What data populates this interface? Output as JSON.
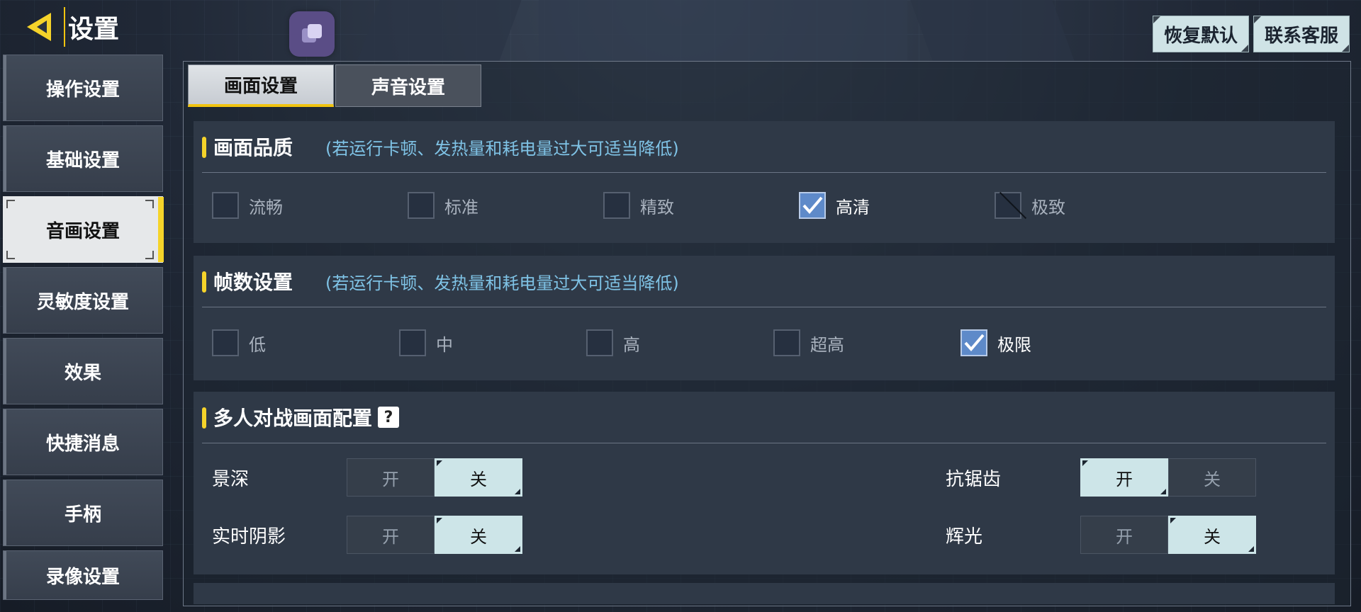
{
  "header": {
    "back_title": "设置",
    "buttons": {
      "restore_default": "恢复默认",
      "contact_support": "联系客服"
    }
  },
  "sidebar": {
    "items": [
      {
        "label": "操作设置",
        "active": false
      },
      {
        "label": "基础设置",
        "active": false
      },
      {
        "label": "音画设置",
        "active": true
      },
      {
        "label": "灵敏度设置",
        "active": false
      },
      {
        "label": "效果",
        "active": false
      },
      {
        "label": "快捷消息",
        "active": false
      },
      {
        "label": "手柄",
        "active": false
      },
      {
        "label": "录像设置",
        "active": false
      }
    ]
  },
  "tabs": [
    {
      "label": "画面设置",
      "active": true
    },
    {
      "label": "声音设置",
      "active": false
    }
  ],
  "quality": {
    "title": "画面品质",
    "hint": "(若运行卡顿、发热量和耗电量过大可适当降低)",
    "options": [
      {
        "label": "流畅",
        "state": "unchecked"
      },
      {
        "label": "标准",
        "state": "unchecked"
      },
      {
        "label": "精致",
        "state": "unchecked"
      },
      {
        "label": "高清",
        "state": "checked"
      },
      {
        "label": "极致",
        "state": "disabled"
      }
    ]
  },
  "framerate": {
    "title": "帧数设置",
    "hint": "(若运行卡顿、发热量和耗电量过大可适当降低)",
    "options": [
      {
        "label": "低",
        "state": "unchecked"
      },
      {
        "label": "中",
        "state": "unchecked"
      },
      {
        "label": "高",
        "state": "unchecked"
      },
      {
        "label": "超高",
        "state": "unchecked"
      },
      {
        "label": "极限",
        "state": "checked"
      }
    ]
  },
  "multiplayer": {
    "title": "多人对战画面配置",
    "help_label": "?",
    "toggles": [
      {
        "label": "景深",
        "on": "开",
        "off": "关",
        "value": "off"
      },
      {
        "label": "抗锯齿",
        "on": "开",
        "off": "关",
        "value": "on"
      },
      {
        "label": "实时阴影",
        "on": "开",
        "off": "关",
        "value": "off"
      },
      {
        "label": "辉光",
        "on": "开",
        "off": "关",
        "value": "off"
      }
    ]
  },
  "colors": {
    "accent": "#f5d32a",
    "hint": "#7fc3e6",
    "checked": "#5e8ac9",
    "toggle_on": "#cde5e8"
  }
}
